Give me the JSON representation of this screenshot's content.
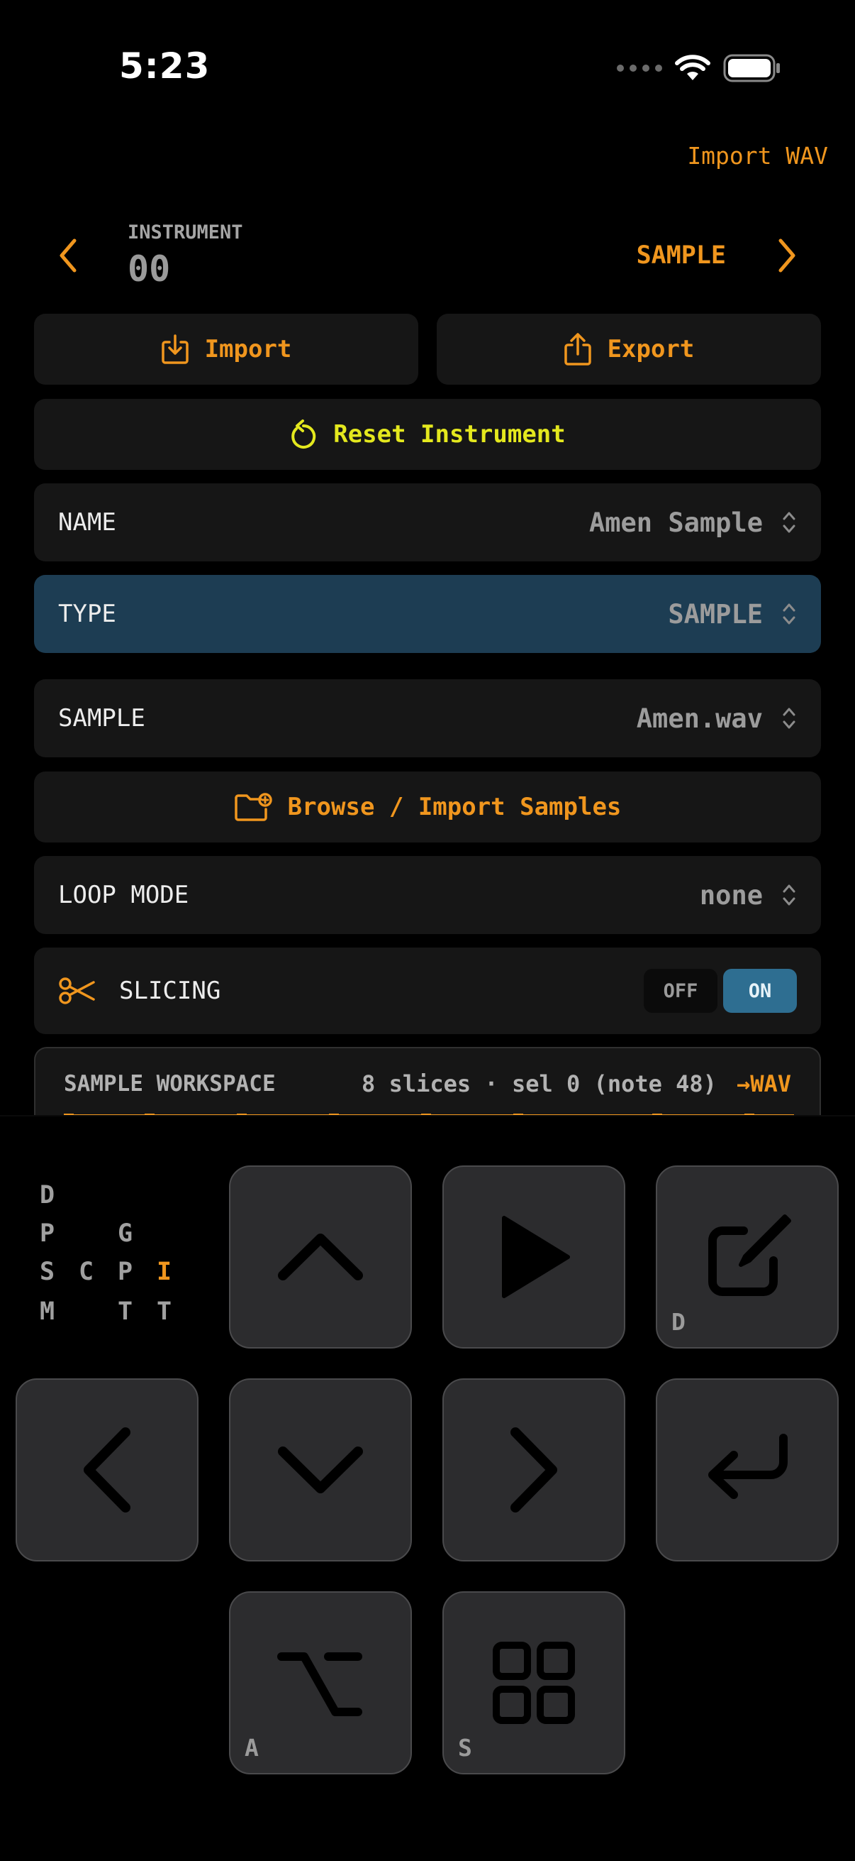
{
  "status": {
    "time": "5:23"
  },
  "header": {
    "import_wav": "Import WAV",
    "instrument_label": "INSTRUMENT",
    "instrument_number": "00",
    "type": "SAMPLE"
  },
  "actions": {
    "import": "Import",
    "export": "Export",
    "reset": "Reset Instrument",
    "browse": "Browse / Import Samples"
  },
  "fields": {
    "name": {
      "label": "NAME",
      "value": "Amen Sample"
    },
    "type": {
      "label": "TYPE",
      "value": "SAMPLE"
    },
    "sample": {
      "label": "SAMPLE",
      "value": "Amen.wav"
    },
    "loop_mode": {
      "label": "LOOP MODE",
      "value": "none"
    }
  },
  "slicing": {
    "label": "SLICING",
    "off": "OFF",
    "on": "ON",
    "state": "ON"
  },
  "workspace": {
    "title": "SAMPLE WORKSPACE",
    "info": "8 slices · sel 0 (note 48)",
    "wav_link": "→WAV"
  },
  "modes": {
    "d": "D",
    "p1": "P",
    "g": "G",
    "s": "S",
    "c": "C",
    "p2": "P",
    "i": "I",
    "m": "M",
    "t1": "T",
    "t2": "T",
    "active": "I"
  },
  "keys": {
    "edit_hint": "D",
    "alt_hint": "A",
    "grid_hint": "S"
  },
  "colors": {
    "accent": "#f0961e",
    "highlight": "#1d3d53",
    "reset": "#e4e81e",
    "toggle_on": "#2e6e91"
  }
}
